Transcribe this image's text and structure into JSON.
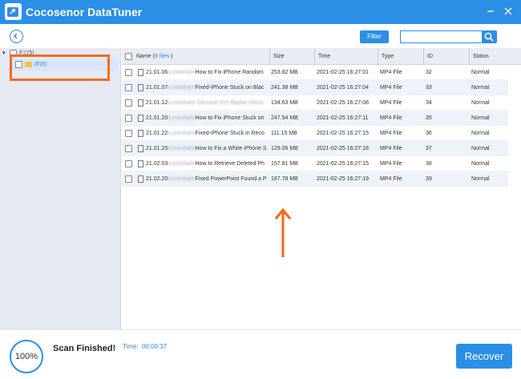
{
  "app": {
    "title": "Cocosenor DataTuner"
  },
  "toolbar": {
    "filter_label": "Filter",
    "search_placeholder": "",
    "search_value": ""
  },
  "tree": {
    "root": {
      "expand_glyph": "▾",
      "label": "F:(75)"
    },
    "child": {
      "label": "JF(8)"
    }
  },
  "table": {
    "headers": {
      "name_prefix": "Name (",
      "name_count": "8 files",
      "name_suffix": " )",
      "size": "Size",
      "time": "Time",
      "type": "Type",
      "id": "ID",
      "status": "Status"
    },
    "rows": [
      {
        "prefix": "21.01.06",
        "blur": "iLoveshare",
        "rest": "How to Fix iPhone Random",
        "size": "253.82 MB",
        "time": "2021-02-25 16:27:01",
        "type": "MP4 File",
        "id": "32",
        "status": "Normal"
      },
      {
        "prefix": "21.01.07",
        "blur": "iLoveshare",
        "rest": "Fixed-iPhone Stuck on Blac",
        "size": "241.38 MB",
        "time": "2021-02-25 16:27:04",
        "type": "MP4 File",
        "id": "33",
        "status": "Normal"
      },
      {
        "prefix": "21.01.12",
        "blur": "iLoveshare Genuine iOS Repair Geniu",
        "rest": "",
        "size": "134.63 MB",
        "time": "2021-02-25 16:27:08",
        "type": "MP4 File",
        "id": "34",
        "status": "Normal"
      },
      {
        "prefix": "21.01.20",
        "blur": "iLoveshare",
        "rest": "How to Fix iPhone Stuck on",
        "size": "247.54 MB",
        "time": "2021-02-25 16:27:11",
        "type": "MP4 File",
        "id": "35",
        "status": "Normal"
      },
      {
        "prefix": "21.01.22",
        "blur": "iLoveshare",
        "rest": "Fixed-iPhone Stuck in Reco",
        "size": "111.15 MB",
        "time": "2021-02-25 16:27:15",
        "type": "MP4 File",
        "id": "36",
        "status": "Normal"
      },
      {
        "prefix": "21.01.25",
        "blur": "iLoveshare",
        "rest": "How to Fix a White iPhone S",
        "size": "129.06 MB",
        "time": "2021-02-25 16:27:18",
        "type": "MP4 File",
        "id": "37",
        "status": "Normal"
      },
      {
        "prefix": "21.02.03",
        "blur": "iLoveshare",
        "rest": "How to Retrieve Deleted Ph",
        "size": "157.81 MB",
        "time": "2021-02-25 16:27:15",
        "type": "MP4 File",
        "id": "38",
        "status": "Normal"
      },
      {
        "prefix": "21.02.20",
        "blur": "iLoveshare",
        "rest": "Fixed PowerPoint Found a P",
        "size": "187.78 MB",
        "time": "2021-02-25 16:27:19",
        "type": "MP4 File",
        "id": "39",
        "status": "Normal"
      }
    ]
  },
  "footer": {
    "progress": "100%",
    "progress_value": 1.0,
    "status": "Scan Finished!",
    "time_label": "Time:",
    "time_value": "00:00:37",
    "recover_label": "Recover"
  },
  "colors": {
    "accent": "#2b8fe6",
    "highlight": "#f36b21"
  },
  "icons": [
    "app-logo-icon",
    "minimize-icon",
    "close-icon",
    "back-icon",
    "search-icon",
    "folder-icon",
    "file-icon",
    "up-arrow-icon"
  ]
}
